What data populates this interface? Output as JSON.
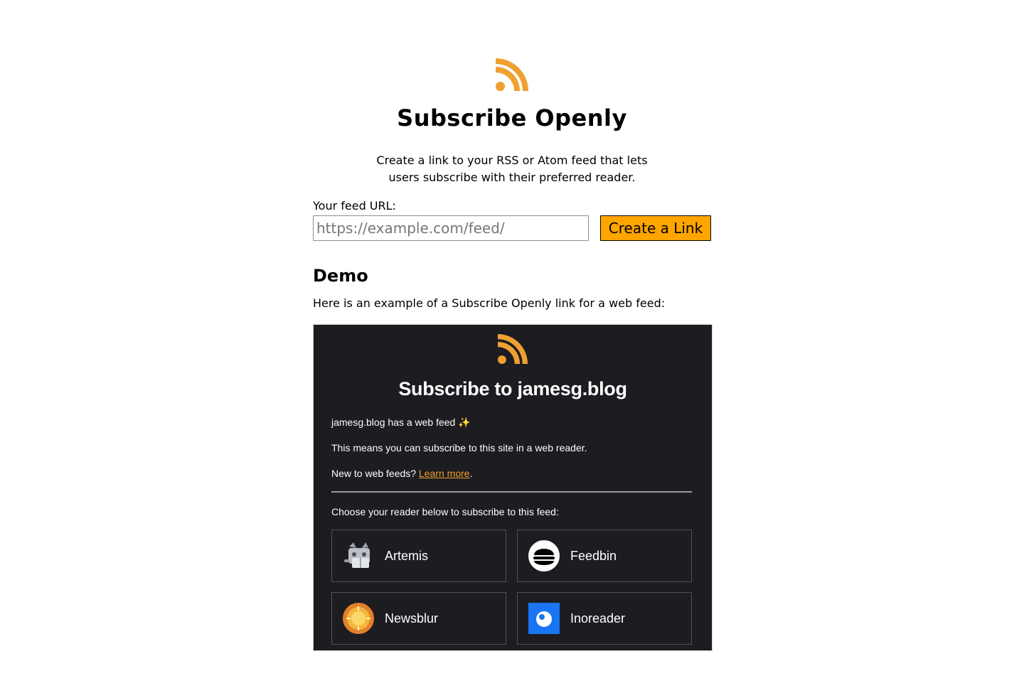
{
  "page": {
    "title": "Subscribe Openly",
    "intro": "Create a link to your RSS or Atom feed that lets users subscribe with their preferred reader."
  },
  "form": {
    "label": "Your feed URL:",
    "placeholder": "https://example.com/feed/",
    "value": "",
    "button_label": "Create a Link"
  },
  "demo_section": {
    "heading": "Demo",
    "description": "Here is an example of a Subscribe Openly link for a web feed:"
  },
  "demo": {
    "title": "Subscribe to jamesg.blog",
    "line1": "jamesg.blog has a web feed ✨",
    "line2": "This means you can subscribe to this site in a web reader.",
    "line3_prefix": "New to web feeds? ",
    "learn_more": "Learn more",
    "line3_suffix": ".",
    "choose_prompt": "Choose your reader below to subscribe to this feed:",
    "readers": [
      {
        "name": "Artemis",
        "icon": "artemis-icon"
      },
      {
        "name": "Feedbin",
        "icon": "feedbin-icon"
      },
      {
        "name": "Newsblur",
        "icon": "newsblur-icon"
      },
      {
        "name": "Inoreader",
        "icon": "inoreader-icon"
      }
    ]
  },
  "colors": {
    "rss_orange": "#f0a030",
    "button_bg": "#ffa500",
    "demo_bg": "#1c1c21",
    "link": "#f0a028",
    "inoreader_blue": "#1875f3"
  }
}
